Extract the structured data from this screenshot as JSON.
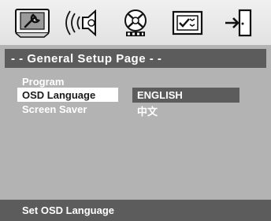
{
  "icon_tabs": [
    {
      "icon": "general-setup-icon"
    },
    {
      "icon": "audio-setup-icon"
    },
    {
      "icon": "video-setup-icon"
    },
    {
      "icon": "preference-setup-icon"
    },
    {
      "icon": "exit-icon"
    }
  ],
  "page_title": "- - General Setup Page - -",
  "menu_items": [
    {
      "label": "Program"
    },
    {
      "label": "OSD Language"
    },
    {
      "label": "Screen Saver"
    }
  ],
  "language_options": [
    {
      "label": "ENGLISH"
    },
    {
      "label": "中文"
    }
  ],
  "status_text": "Set OSD Language",
  "colors": {
    "background": "#b3b3b3",
    "bar": "#5c5c5c",
    "selected": "#ffffff",
    "text": "#ffffff"
  }
}
